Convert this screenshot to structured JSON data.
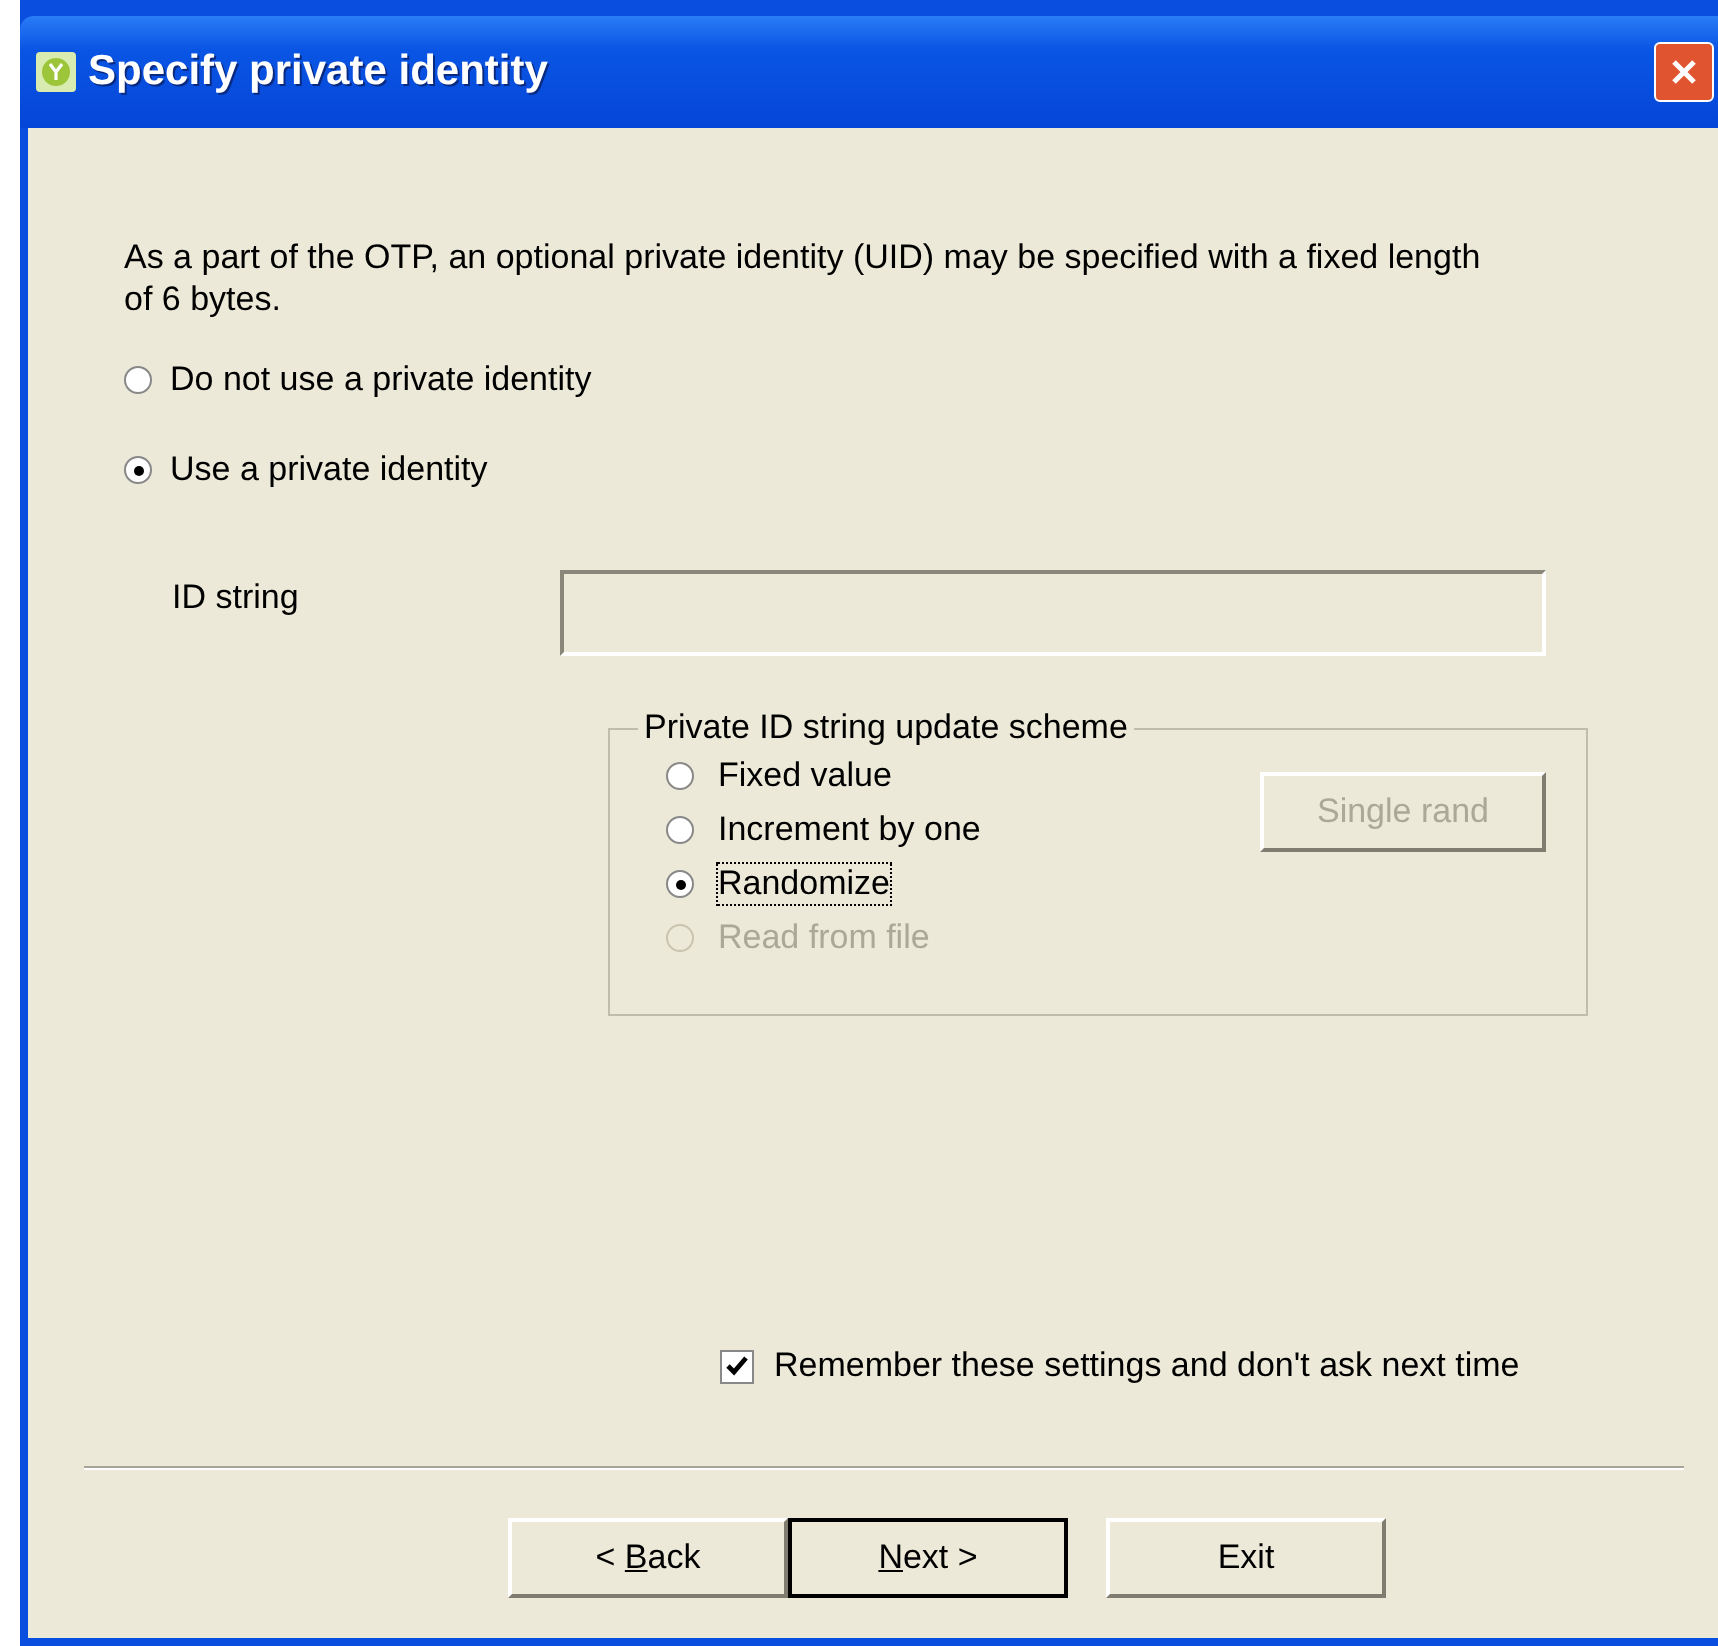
{
  "window": {
    "title": "Specify private identity"
  },
  "intro": "As a part of the OTP, an optional private identity (UID) may be specified with a fixed length of 6 bytes.",
  "identity_options": [
    {
      "label": "Do not use a private identity",
      "selected": false
    },
    {
      "label": "Use a private identity",
      "selected": true
    }
  ],
  "id_string": {
    "label": "ID string",
    "disabled": true
  },
  "update_scheme": {
    "title": "Private ID string update scheme",
    "options": [
      {
        "label": "Fixed value",
        "selected": false,
        "disabled": false,
        "focused": false
      },
      {
        "label": "Increment by one",
        "selected": false,
        "disabled": false,
        "focused": false
      },
      {
        "label": "Randomize",
        "selected": true,
        "disabled": false,
        "focused": true
      },
      {
        "label": "Read from file",
        "selected": false,
        "disabled": true,
        "focused": false
      }
    ],
    "button": {
      "label": "Single rand",
      "disabled": true
    }
  },
  "remember": {
    "label": "Remember these settings and don't ask next time",
    "checked": true
  },
  "buttons": [
    {
      "before": "< ",
      "key": "B",
      "after": "ack",
      "default": false
    },
    {
      "key": "N",
      "after": "ext >",
      "default": true
    },
    {
      "before": "Exit",
      "default": false
    }
  ]
}
